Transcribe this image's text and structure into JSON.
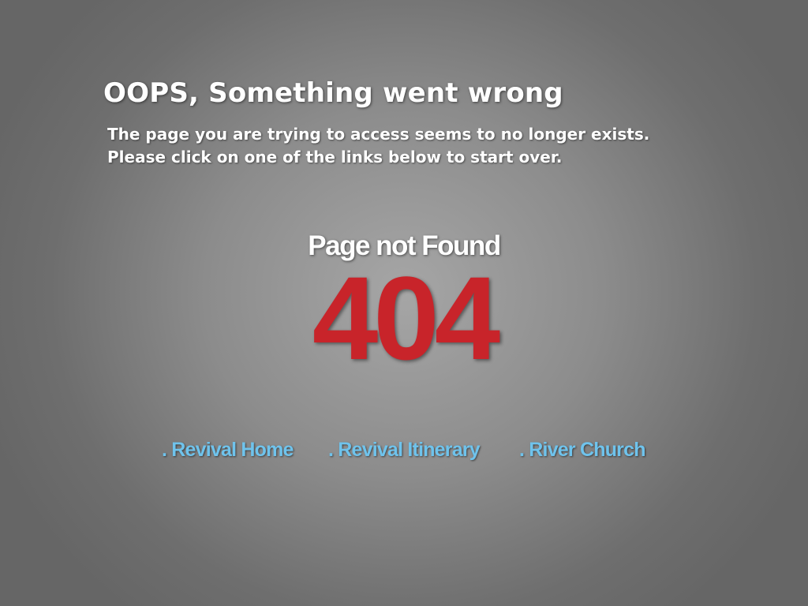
{
  "error": {
    "headline": "OOPS, Something went wrong",
    "message_line_1": "The page you are trying to access seems to no longer exists.",
    "message_line_2": "Please click on one of the links below to start over.",
    "subtitle": "Page not Found",
    "code": "404"
  },
  "links": [
    {
      "label": ". Revival Home"
    },
    {
      "label": ". Revival Itinerary"
    },
    {
      "label": ". River Church"
    }
  ],
  "colors": {
    "code": "#c8242a",
    "link": "#6fc3ec",
    "text": "#ffffff",
    "background": "#8c8c8c"
  }
}
